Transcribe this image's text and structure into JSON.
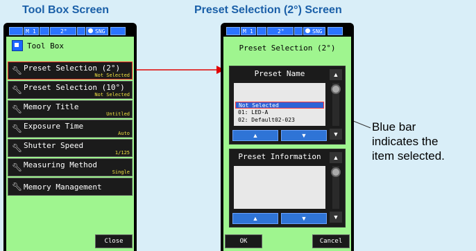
{
  "captions": {
    "left": "Tool Box Screen",
    "right": "Preset Selection (2°) Screen"
  },
  "status_bar": {
    "memory": "M",
    "memory_num": "1",
    "angle": "2°",
    "mode": "SNG"
  },
  "toolbox": {
    "title": "Tool Box",
    "items": [
      {
        "label": "Preset Selection (2°)",
        "value": "Not Selected"
      },
      {
        "label": "Preset Selection (10°)",
        "value": "Not Selected"
      },
      {
        "label": "Memory Title",
        "value": "Untitled"
      },
      {
        "label": "Exposure Time",
        "value": "Auto"
      },
      {
        "label": "Shutter Speed",
        "value": "1/125"
      },
      {
        "label": "Measuring Method",
        "value": "Single"
      },
      {
        "label": "Memory Management",
        "value": ""
      }
    ],
    "close_label": "Close"
  },
  "preset": {
    "title": "Preset Selection (2°)",
    "name_panel_title": "Preset Name",
    "list": [
      "Not Selected",
      "01: LED-A",
      "02: Default02-023"
    ],
    "selected_index": 0,
    "info_panel_title": "Preset Information",
    "ok_label": "OK",
    "cancel_label": "Cancel"
  },
  "annotation": {
    "line1": "Blue bar",
    "line2": "indicates the",
    "line3": "item selected."
  },
  "colors": {
    "screen_bg": "#9ff58f",
    "caption": "#1a5fa8",
    "highlight_red": "#ff2a2a",
    "selection_blue": "#2e63d6",
    "value_yellow": "#f0e040"
  },
  "icons": [
    "toolbox-icon",
    "wrench-icon",
    "up-arrow-icon",
    "down-arrow-icon",
    "scroll-top-icon",
    "scroll-bottom-icon"
  ]
}
